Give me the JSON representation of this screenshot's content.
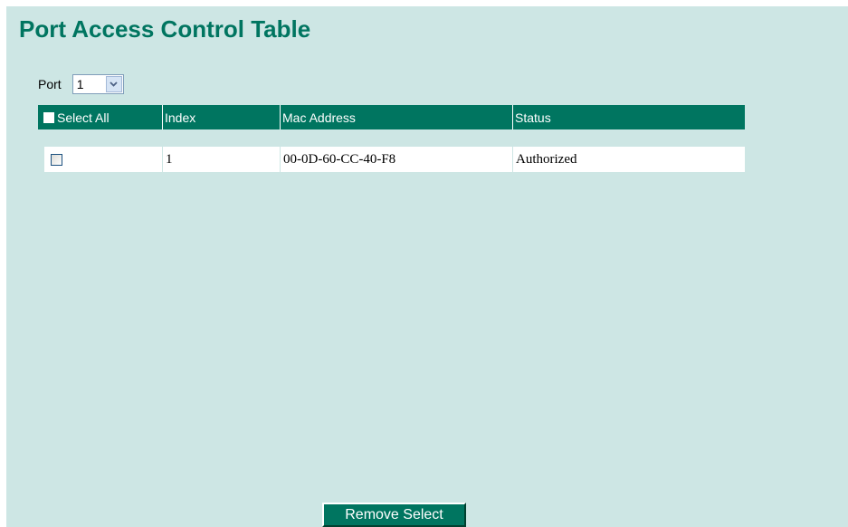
{
  "page": {
    "title": "Port Access Control Table"
  },
  "port_selector": {
    "label": "Port",
    "selected_value": "1"
  },
  "table": {
    "headers": {
      "select_all": "Select All",
      "index": "Index",
      "mac_address": "Mac Address",
      "status": "Status"
    },
    "rows": [
      {
        "checked": false,
        "index": "1",
        "mac_address": "00-0D-60-CC-40-F8",
        "status": "Authorized"
      }
    ]
  },
  "actions": {
    "remove_select_label": "Remove Select"
  },
  "colors": {
    "background": "#cde6e4",
    "accent": "#007560",
    "header_text": "#ffffff"
  }
}
